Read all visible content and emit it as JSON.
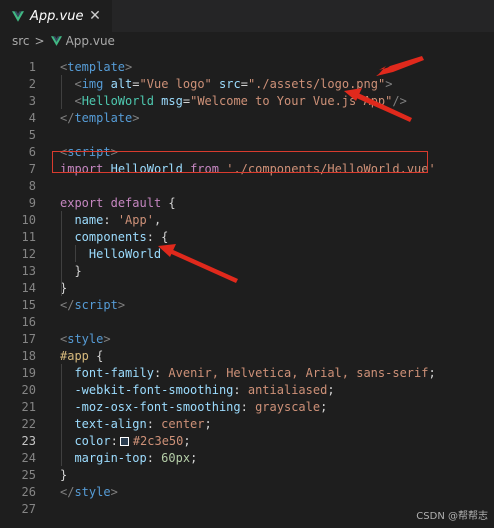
{
  "tab": {
    "label": "App.vue",
    "close_glyph": "✕",
    "icon": "vue-logo-icon"
  },
  "breadcrumb": {
    "folder": "src",
    "separator": ">",
    "file": "App.vue"
  },
  "editor": {
    "active_line": 23,
    "lines": [
      {
        "n": "1",
        "tokens": [
          [
            "t-br",
            "<"
          ],
          [
            "t-tag",
            "template"
          ],
          [
            "t-br",
            ">"
          ]
        ]
      },
      {
        "n": "2",
        "tokens": [
          [
            "t-plain",
            "  "
          ],
          [
            "t-br",
            "<"
          ],
          [
            "t-tag",
            "img"
          ],
          [
            "t-plain",
            " "
          ],
          [
            "t-attr",
            "alt"
          ],
          [
            "t-plain",
            "="
          ],
          [
            "t-str",
            "\"Vue logo\""
          ],
          [
            "t-plain",
            " "
          ],
          [
            "t-attr",
            "src"
          ],
          [
            "t-plain",
            "="
          ],
          [
            "t-str",
            "\"./assets/logo.png\""
          ],
          [
            "t-br",
            ">"
          ]
        ]
      },
      {
        "n": "3",
        "tokens": [
          [
            "t-plain",
            "  "
          ],
          [
            "t-br",
            "<"
          ],
          [
            "t-comp",
            "HelloWorld"
          ],
          [
            "t-plain",
            " "
          ],
          [
            "t-attr",
            "msg"
          ],
          [
            "t-plain",
            "="
          ],
          [
            "t-str",
            "\"Welcome to Your Vue.js App\""
          ],
          [
            "t-br",
            "/>"
          ]
        ]
      },
      {
        "n": "4",
        "tokens": [
          [
            "t-br",
            "</"
          ],
          [
            "t-tag",
            "template"
          ],
          [
            "t-br",
            ">"
          ]
        ]
      },
      {
        "n": "5",
        "tokens": []
      },
      {
        "n": "6",
        "tokens": [
          [
            "t-br",
            "<"
          ],
          [
            "t-tag",
            "script"
          ],
          [
            "t-br",
            ">"
          ]
        ]
      },
      {
        "n": "7",
        "tokens": [
          [
            "t-kw",
            "import"
          ],
          [
            "t-plain",
            " "
          ],
          [
            "t-ident",
            "HelloWorld"
          ],
          [
            "t-plain",
            " "
          ],
          [
            "t-kw",
            "from"
          ],
          [
            "t-plain",
            " "
          ],
          [
            "t-str",
            "'./components/HelloWorld.vue'"
          ]
        ]
      },
      {
        "n": "8",
        "tokens": []
      },
      {
        "n": "9",
        "tokens": [
          [
            "t-kw",
            "export"
          ],
          [
            "t-plain",
            " "
          ],
          [
            "t-kw",
            "default"
          ],
          [
            "t-plain",
            " {"
          ]
        ]
      },
      {
        "n": "10",
        "tokens": [
          [
            "t-plain",
            "  "
          ],
          [
            "t-ident",
            "name"
          ],
          [
            "t-plain",
            ": "
          ],
          [
            "t-str",
            "'App'"
          ],
          [
            "t-plain",
            ","
          ]
        ]
      },
      {
        "n": "11",
        "tokens": [
          [
            "t-plain",
            "  "
          ],
          [
            "t-ident",
            "components"
          ],
          [
            "t-plain",
            ": {"
          ]
        ]
      },
      {
        "n": "12",
        "tokens": [
          [
            "t-plain",
            "    "
          ],
          [
            "t-ident",
            "HelloWorld"
          ]
        ]
      },
      {
        "n": "13",
        "tokens": [
          [
            "t-plain",
            "  }"
          ]
        ]
      },
      {
        "n": "14",
        "tokens": [
          [
            "t-plain",
            "}"
          ]
        ]
      },
      {
        "n": "15",
        "tokens": [
          [
            "t-br",
            "</"
          ],
          [
            "t-tag",
            "script"
          ],
          [
            "t-br",
            ">"
          ]
        ]
      },
      {
        "n": "16",
        "tokens": []
      },
      {
        "n": "17",
        "tokens": [
          [
            "t-br",
            "<"
          ],
          [
            "t-tag",
            "style"
          ],
          [
            "t-br",
            ">"
          ]
        ]
      },
      {
        "n": "18",
        "tokens": [
          [
            "t-sel",
            "#app"
          ],
          [
            "t-plain",
            " {"
          ]
        ]
      },
      {
        "n": "19",
        "tokens": [
          [
            "t-plain",
            "  "
          ],
          [
            "t-prop",
            "font-family"
          ],
          [
            "t-plain",
            ": "
          ],
          [
            "t-str",
            "Avenir, Helvetica, Arial, sans-serif"
          ],
          [
            "t-plain",
            ";"
          ]
        ]
      },
      {
        "n": "20",
        "tokens": [
          [
            "t-plain",
            "  "
          ],
          [
            "t-prop",
            "-webkit-font-smoothing"
          ],
          [
            "t-plain",
            ": "
          ],
          [
            "t-str",
            "antialiased"
          ],
          [
            "t-plain",
            ";"
          ]
        ]
      },
      {
        "n": "21",
        "tokens": [
          [
            "t-plain",
            "  "
          ],
          [
            "t-prop",
            "-moz-osx-font-smoothing"
          ],
          [
            "t-plain",
            ": "
          ],
          [
            "t-str",
            "grayscale"
          ],
          [
            "t-plain",
            ";"
          ]
        ]
      },
      {
        "n": "22",
        "tokens": [
          [
            "t-plain",
            "  "
          ],
          [
            "t-prop",
            "text-align"
          ],
          [
            "t-plain",
            ": "
          ],
          [
            "t-str",
            "center"
          ],
          [
            "t-plain",
            ";"
          ]
        ]
      },
      {
        "n": "23",
        "tokens": [
          [
            "t-plain",
            "  "
          ],
          [
            "t-prop",
            "color"
          ],
          [
            "t-plain",
            ":"
          ],
          [
            "swatch",
            ""
          ],
          [
            "t-str",
            "#2c3e50"
          ],
          [
            "t-plain",
            ";"
          ]
        ]
      },
      {
        "n": "24",
        "tokens": [
          [
            "t-plain",
            "  "
          ],
          [
            "t-prop",
            "margin-top"
          ],
          [
            "t-plain",
            ": "
          ],
          [
            "t-num",
            "60px"
          ],
          [
            "t-plain",
            ";"
          ]
        ]
      },
      {
        "n": "25",
        "tokens": [
          [
            "t-plain",
            "}"
          ]
        ]
      },
      {
        "n": "26",
        "tokens": [
          [
            "t-br",
            "</"
          ],
          [
            "t-tag",
            "style"
          ],
          [
            "t-br",
            ">"
          ]
        ]
      },
      {
        "n": "27",
        "tokens": []
      }
    ]
  },
  "colors": {
    "swatch": "#2c3e50",
    "annotation_red": "#e0291c",
    "vue_green": "#41b883"
  },
  "watermark": "CSDN @帮帮志"
}
